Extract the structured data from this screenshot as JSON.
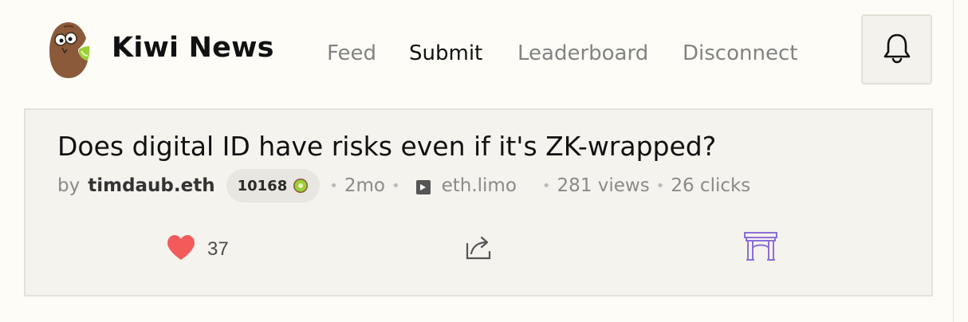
{
  "brand": {
    "name": "Kiwi News",
    "logo_icon": "kiwi-mascot-icon"
  },
  "nav": {
    "items": [
      {
        "label": "Feed",
        "active": false
      },
      {
        "label": "Submit",
        "active": true
      },
      {
        "label": "Leaderboard",
        "active": false
      },
      {
        "label": "Disconnect",
        "active": false
      }
    ]
  },
  "notifications": {
    "icon": "bell-icon"
  },
  "story": {
    "title": "Does digital ID have risks even if it's ZK-wrapped?",
    "by_label": "by",
    "author": "timdaub.eth",
    "karma": "10168",
    "karma_icon": "kiwi-slice-icon",
    "age": "2mo",
    "domain": "eth.limo",
    "domain_icon": "favicon-icon",
    "views": "281 views",
    "clicks": "26 clicks",
    "separator": "•"
  },
  "actions": {
    "upvote_count": "37",
    "upvote_icon": "heart-icon",
    "share_icon": "share-icon",
    "archive_icon": "arch-icon"
  },
  "colors": {
    "background": "#fdfcf7",
    "card": "#f5f3ee",
    "heart": "#f35b5b",
    "arch": "#8b6fd6",
    "muted": "#828282"
  }
}
